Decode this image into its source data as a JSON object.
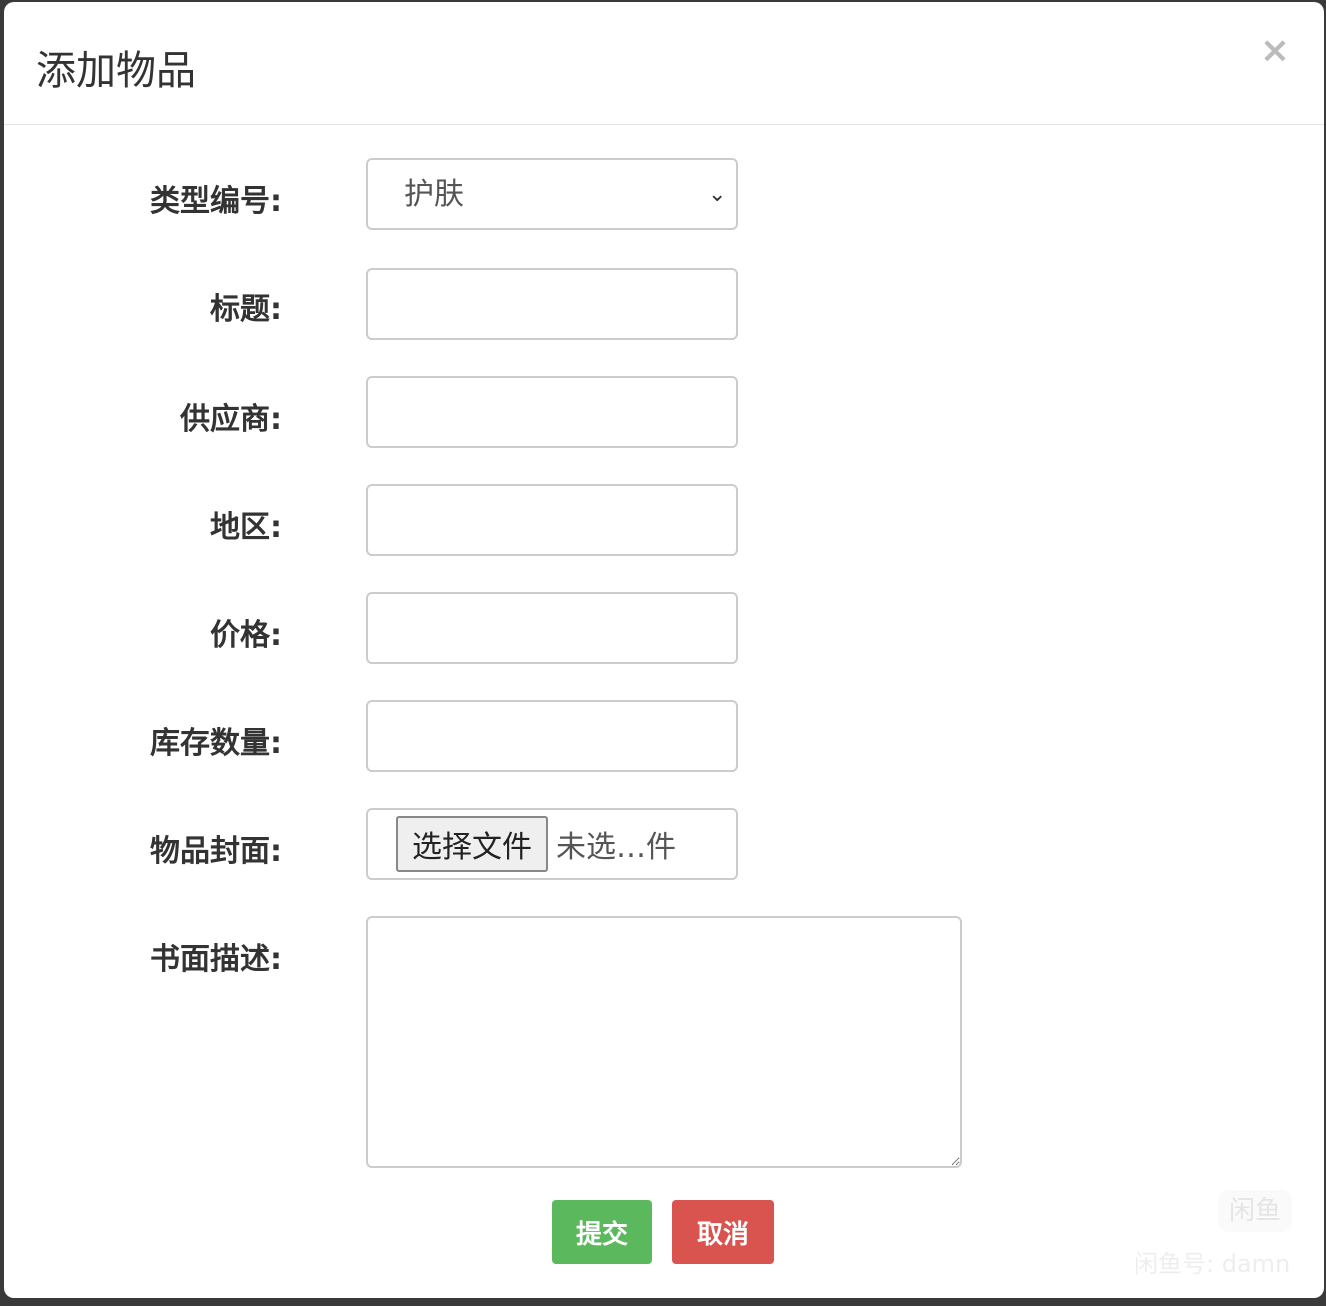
{
  "dialog": {
    "title": "添加物品",
    "close_icon": "×"
  },
  "form": {
    "type_label": "类型编号:",
    "type_value": "护肤",
    "title_label": "标题:",
    "title_value": "",
    "supplier_label": "供应商:",
    "supplier_value": "",
    "region_label": "地区:",
    "region_value": "",
    "price_label": "价格:",
    "price_value": "",
    "stock_label": "库存数量:",
    "stock_value": "",
    "cover_label": "物品封面:",
    "file_button": "选择文件",
    "file_status": "未选…件",
    "desc_label": "书面描述:",
    "desc_value": ""
  },
  "buttons": {
    "submit": "提交",
    "cancel": "取消"
  },
  "watermark": {
    "logo": "闲鱼",
    "text": "闲鱼号: damn"
  }
}
